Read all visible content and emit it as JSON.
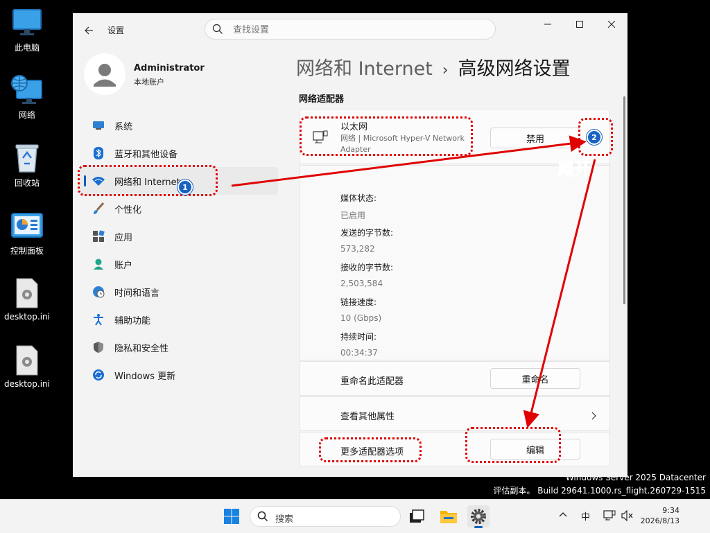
{
  "desktop": {
    "icons": [
      {
        "label": "此电脑",
        "icon": "monitor-icon"
      },
      {
        "label": "网络",
        "icon": "network-globe-icon"
      },
      {
        "label": "回收站",
        "icon": "recycle-bin-icon"
      },
      {
        "label": "控制面板",
        "icon": "control-panel-icon"
      },
      {
        "label": "desktop.ini",
        "icon": "settings-file-icon"
      },
      {
        "label": "desktop.ini",
        "icon": "settings-file-icon"
      }
    ]
  },
  "window": {
    "app_title": "设置",
    "search_placeholder": "查找设置"
  },
  "profile": {
    "name": "Administrator",
    "type": "本地账户"
  },
  "nav": [
    {
      "label": "系统",
      "icon": "system-display-icon"
    },
    {
      "label": "蓝牙和其他设备",
      "icon": "bluetooth-icon"
    },
    {
      "label": "网络和 Internet",
      "icon": "wifi-icon",
      "active": true
    },
    {
      "label": "个性化",
      "icon": "brush-icon"
    },
    {
      "label": "应用",
      "icon": "apps-icon"
    },
    {
      "label": "账户",
      "icon": "account-icon"
    },
    {
      "label": "时间和语言",
      "icon": "globe-clock-icon"
    },
    {
      "label": "辅助功能",
      "icon": "accessibility-icon"
    },
    {
      "label": "隐私和安全性",
      "icon": "shield-icon"
    },
    {
      "label": "Windows 更新",
      "icon": "update-icon"
    }
  ],
  "breadcrumb": {
    "parent": "网络和 Internet",
    "separator": "›",
    "current": "高级网络设置"
  },
  "section_title": "网络适配器",
  "adapter": {
    "name": "以太网",
    "description": "网络 | Microsoft Hyper-V Network Adapter",
    "disable_button": "禁用",
    "properties": [
      {
        "key": "媒体状态:",
        "value": "已启用"
      },
      {
        "key": "发送的字节数:",
        "value": "573,282"
      },
      {
        "key": "接收的字节数:",
        "value": "2,503,584"
      },
      {
        "key": "链接速度:",
        "value": "10 (Gbps)"
      },
      {
        "key": "持续时间:",
        "value": "00:34:37"
      }
    ]
  },
  "rows": {
    "rename_label": "重命名此适配器",
    "rename_button": "重命名",
    "more_properties_label": "查看其他属性",
    "more_options_label": "更多适配器选项",
    "edit_button": "编辑"
  },
  "watermark": {
    "line1": "Windows Server 2025 Datacenter",
    "line2": "评估副本。 Build 29641.1000.rs_flight.260729-1515"
  },
  "taskbar": {
    "search_label": "搜索",
    "ime": "中",
    "time": "9:34",
    "date": "2026/8/13"
  },
  "annotations": {
    "badge1": "1",
    "badge2": "2",
    "expand_label": "展开",
    "color": "#e00000"
  },
  "colors": {
    "accent": "#005fb8",
    "annotation_red": "#e00000",
    "badge_blue": "#1862c4"
  }
}
